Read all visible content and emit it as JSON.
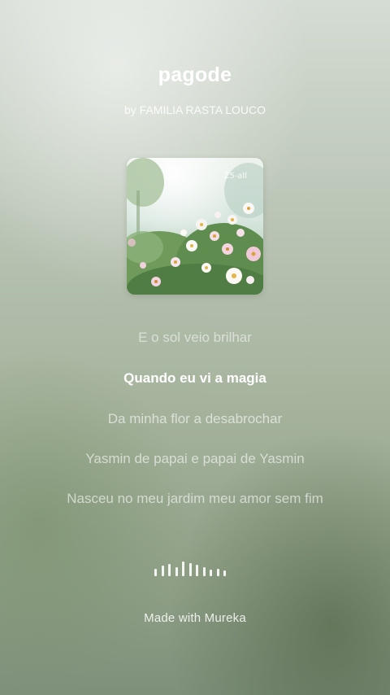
{
  "song": {
    "title": "pagode",
    "artist_line": "by FAMILIA RASTA LOUCO"
  },
  "cover": {
    "alt": "album-cover-flowers",
    "stamp": "Ž5-all"
  },
  "lyrics": [
    {
      "text": "E o sol veio brilhar",
      "state": "past"
    },
    {
      "text": "Quando eu vi a magia",
      "state": "active"
    },
    {
      "text": "Da minha flor a desabrochar",
      "state": "upcoming"
    },
    {
      "text": "Yasmin de papai e papai de Yasmin",
      "state": "upcoming"
    },
    {
      "text": "Nasceu no meu jardim meu amor sem fim",
      "state": "upcoming"
    }
  ],
  "audio": {
    "icon": "waveform-icon",
    "levels": [
      0.5,
      0.7,
      0.85,
      0.6,
      1.0,
      0.9,
      0.75,
      0.6,
      0.45,
      0.5,
      0.4
    ]
  },
  "footer": {
    "text": "Made with Mureka"
  }
}
